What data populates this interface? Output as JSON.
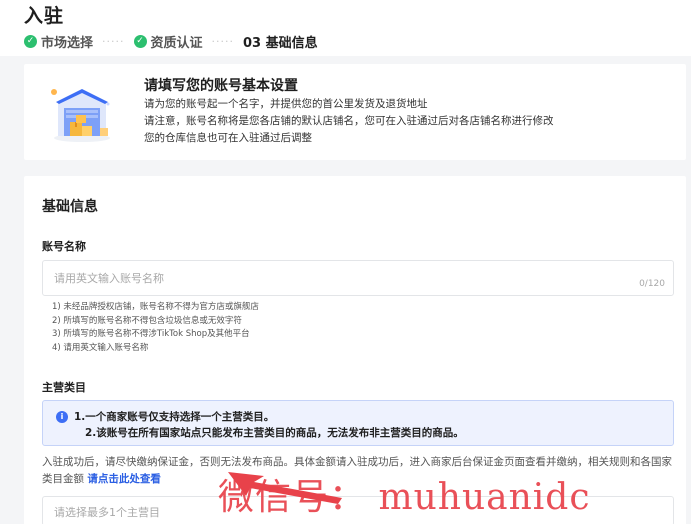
{
  "header": {
    "title": "入驻",
    "steps": [
      {
        "label": "市场选择",
        "status": "done"
      },
      {
        "label": "资质认证",
        "status": "done"
      },
      {
        "label": "03 基础信息",
        "status": "current"
      }
    ],
    "separator": "·····"
  },
  "intro": {
    "title": "请填写您的账号基本设置",
    "lines": [
      "请为您的账号起一个名字，并提供您的首公里发货及退货地址",
      "请注意，账号名称将是您各店铺的默认店铺名，您可在入驻通过后对各店铺名称进行修改",
      "您的仓库信息也可在入驻通过后调整"
    ]
  },
  "form": {
    "section_title": "基础信息",
    "account_name": {
      "label": "账号名称",
      "placeholder": "请用英文输入账号名称",
      "counter": "0/120",
      "rules": [
        "1) 未经品牌授权店铺，账号名称不得为官方店或旗舰店",
        "2) 所填写的账号名称不得包含垃圾信息或无效字符",
        "3) 所填写的账号名称不得涉TikTok Shop及其他平台",
        "4) 请用英文输入账号名称"
      ]
    },
    "main_category": {
      "label": "主营类目",
      "notice": [
        "1.一个商家账号仅支持选择一个主营类目。",
        "2.该账号在所有国家站点只能发布主营类目的商品，无法发布非主营类目的商品。"
      ],
      "desc_before_link": "入驻成功后，请尽快缴纳保证金，否则无法发布商品。具体金额请入驻成功后，进入商家后台保证金页面查看并缴纳，相关规则和各国家类目金额 ",
      "link": "请点击此处查看",
      "placeholder": "请选择最多1个主营目"
    }
  },
  "watermark": "微信号：  muhuanidc",
  "colors": {
    "accent": "#2b5fe3",
    "success": "#2cbf6f",
    "notice_bg": "#eef2fe",
    "watermark": "#e8424a"
  }
}
